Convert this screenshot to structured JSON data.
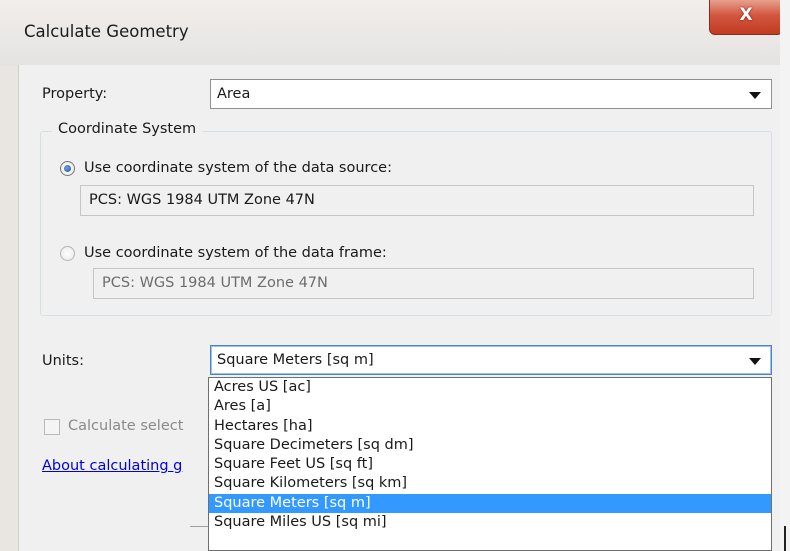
{
  "window": {
    "title": "Calculate Geometry",
    "close_glyph": "X"
  },
  "property": {
    "label": "Property:",
    "value": "Area"
  },
  "coordinate_system": {
    "legend": "Coordinate System",
    "data_source": {
      "label": "Use coordinate system of the data source:",
      "value": "PCS: WGS 1984 UTM Zone 47N",
      "selected": true
    },
    "data_frame": {
      "label": "Use coordinate system of the data frame:",
      "value": "PCS: WGS 1984 UTM Zone 47N",
      "selected": false
    }
  },
  "units": {
    "label": "Units:",
    "value": "Square Meters [sq m]",
    "options": [
      "Acres US [ac]",
      "Ares [a]",
      "Hectares [ha]",
      "Square Decimeters [sq dm]",
      "Square Feet US [sq ft]",
      "Square Kilometers [sq km]",
      "Square Meters [sq m]",
      "Square Miles US [sq mi]"
    ],
    "highlighted": "Square Meters [sq m]"
  },
  "calculate_selected": {
    "label_visible": "Calculate select",
    "checked": false
  },
  "about_link": {
    "text_visible": "About calculating g"
  },
  "colors": {
    "selection": "#3399ff",
    "link": "#0000e0",
    "close_button": "#c23b22"
  }
}
